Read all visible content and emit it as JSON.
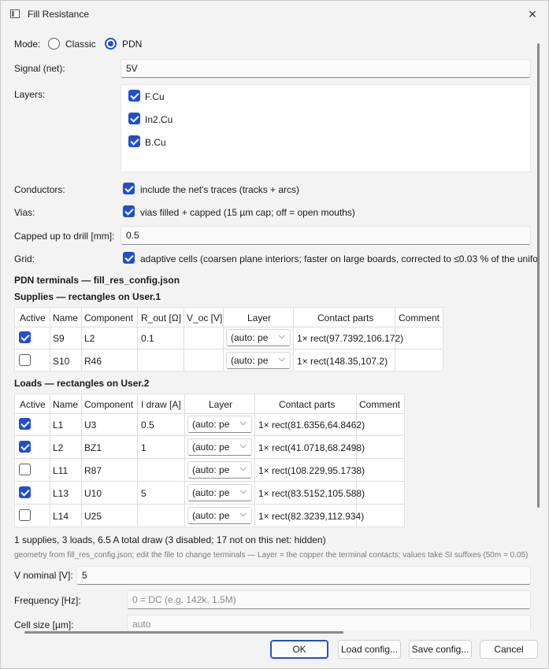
{
  "window": {
    "title": "Fill Resistance",
    "close_icon": "×"
  },
  "mode": {
    "label": "Mode:",
    "options": [
      "Classic",
      "PDN"
    ],
    "selected": "PDN"
  },
  "signal": {
    "label": "Signal (net):",
    "value": "5V"
  },
  "layers": {
    "label": "Layers:",
    "items": [
      {
        "name": "F.Cu",
        "checked": true
      },
      {
        "name": "In2.Cu",
        "checked": true
      },
      {
        "name": "B.Cu",
        "checked": true
      }
    ]
  },
  "conductors": {
    "label": "Conductors:",
    "checkbox_label": "include the net's traces (tracks + arcs)",
    "checked": true
  },
  "vias": {
    "label": "Vias:",
    "checkbox_label": "vias filled + capped (15 µm cap; off = open mouths)",
    "checked": true
  },
  "capped": {
    "label": "Capped up to drill [mm]:",
    "value": "0.5"
  },
  "grid": {
    "label": "Grid:",
    "checkbox_label": "adaptive cells (coarsen plane interiors; faster on large boards, corrected to ≤0.03 % of the uniform",
    "checked": true
  },
  "pdn": {
    "heading": "PDN terminals — fill_res_config.json"
  },
  "supplies": {
    "heading": "Supplies — rectangles on User.1",
    "columns": [
      "Active",
      "Name",
      "Component",
      "R_out [Ω]",
      "V_oc [V]",
      "Layer",
      "Contact parts",
      "Comment"
    ],
    "rows": [
      {
        "active": true,
        "name": "S9",
        "component": "L2",
        "r_out": "0.1",
        "v_oc": "",
        "layer": "(auto: pe",
        "contact": "1× rect(97.7392,106.172)",
        "comment": ""
      },
      {
        "active": false,
        "name": "S10",
        "component": "R46",
        "r_out": "",
        "v_oc": "",
        "layer": "(auto: pe",
        "contact": "1× rect(148.35,107.2)",
        "comment": ""
      }
    ]
  },
  "loads": {
    "heading": "Loads — rectangles on User.2",
    "columns": [
      "Active",
      "Name",
      "Component",
      "I draw [A]",
      "Layer",
      "Contact parts",
      "Comment"
    ],
    "rows": [
      {
        "active": true,
        "name": "L1",
        "component": "U3",
        "i_draw": "0.5",
        "layer": "(auto: pe",
        "contact": "1× rect(81.6356,64.8462)",
        "comment": ""
      },
      {
        "active": true,
        "name": "L2",
        "component": "BZ1",
        "i_draw": "1",
        "layer": "(auto: pe",
        "contact": "1× rect(41.0718,68.2498)",
        "comment": ""
      },
      {
        "active": false,
        "name": "L11",
        "component": "R87",
        "i_draw": "",
        "layer": "(auto: pe",
        "contact": "1× rect(108.229,95.1738)",
        "comment": ""
      },
      {
        "active": true,
        "name": "L13",
        "component": "U10",
        "i_draw": "5",
        "layer": "(auto: pe",
        "contact": "1× rect(83.5152,105.588)",
        "comment": ""
      },
      {
        "active": false,
        "name": "L14",
        "component": "U25",
        "i_draw": "",
        "layer": "(auto: pe",
        "contact": "1× rect(82.3239,112.934)",
        "comment": ""
      }
    ]
  },
  "summary": "1 supplies, 3 loads, 6.5 A total draw (3 disabled; 17 not on this net: hidden)",
  "note": "geometry from fill_res_config.json; edit the file to change terminals — Layer = the copper the terminal contacts; values take SI suffixes (50m = 0.05)",
  "v_nominal": {
    "label": "V nominal [V]:",
    "value": "5"
  },
  "frequency": {
    "label": "Frequency [Hz]:",
    "placeholder": "0 = DC   (e.g. 142k, 1.5M)"
  },
  "cell_size": {
    "label": "Cell size [µm]:",
    "placeholder": "auto"
  },
  "buttons": {
    "ok": "OK",
    "load": "Load config...",
    "save": "Save config...",
    "cancel": "Cancel"
  },
  "icons": {
    "chevron": "⌵"
  }
}
